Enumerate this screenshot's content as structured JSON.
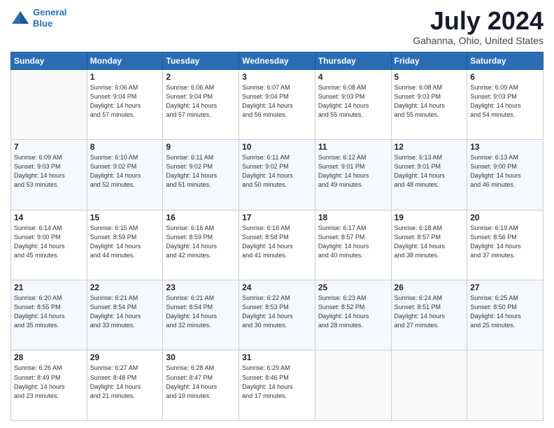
{
  "logo": {
    "line1": "General",
    "line2": "Blue"
  },
  "title": "July 2024",
  "subtitle": "Gahanna, Ohio, United States",
  "calendar": {
    "headers": [
      "Sunday",
      "Monday",
      "Tuesday",
      "Wednesday",
      "Thursday",
      "Friday",
      "Saturday"
    ],
    "rows": [
      [
        {
          "day": "",
          "info": ""
        },
        {
          "day": "1",
          "info": "Sunrise: 6:06 AM\nSunset: 9:04 PM\nDaylight: 14 hours\nand 57 minutes."
        },
        {
          "day": "2",
          "info": "Sunrise: 6:06 AM\nSunset: 9:04 PM\nDaylight: 14 hours\nand 57 minutes."
        },
        {
          "day": "3",
          "info": "Sunrise: 6:07 AM\nSunset: 9:04 PM\nDaylight: 14 hours\nand 56 minutes."
        },
        {
          "day": "4",
          "info": "Sunrise: 6:08 AM\nSunset: 9:03 PM\nDaylight: 14 hours\nand 55 minutes."
        },
        {
          "day": "5",
          "info": "Sunrise: 6:08 AM\nSunset: 9:03 PM\nDaylight: 14 hours\nand 55 minutes."
        },
        {
          "day": "6",
          "info": "Sunrise: 6:09 AM\nSunset: 9:03 PM\nDaylight: 14 hours\nand 54 minutes."
        }
      ],
      [
        {
          "day": "7",
          "info": "Sunrise: 6:09 AM\nSunset: 9:03 PM\nDaylight: 14 hours\nand 53 minutes."
        },
        {
          "day": "8",
          "info": "Sunrise: 6:10 AM\nSunset: 9:02 PM\nDaylight: 14 hours\nand 52 minutes."
        },
        {
          "day": "9",
          "info": "Sunrise: 6:11 AM\nSunset: 9:02 PM\nDaylight: 14 hours\nand 51 minutes."
        },
        {
          "day": "10",
          "info": "Sunrise: 6:11 AM\nSunset: 9:02 PM\nDaylight: 14 hours\nand 50 minutes."
        },
        {
          "day": "11",
          "info": "Sunrise: 6:12 AM\nSunset: 9:01 PM\nDaylight: 14 hours\nand 49 minutes."
        },
        {
          "day": "12",
          "info": "Sunrise: 6:13 AM\nSunset: 9:01 PM\nDaylight: 14 hours\nand 48 minutes."
        },
        {
          "day": "13",
          "info": "Sunrise: 6:13 AM\nSunset: 9:00 PM\nDaylight: 14 hours\nand 46 minutes."
        }
      ],
      [
        {
          "day": "14",
          "info": "Sunrise: 6:14 AM\nSunset: 9:00 PM\nDaylight: 14 hours\nand 45 minutes."
        },
        {
          "day": "15",
          "info": "Sunrise: 6:15 AM\nSunset: 8:59 PM\nDaylight: 14 hours\nand 44 minutes."
        },
        {
          "day": "16",
          "info": "Sunrise: 6:16 AM\nSunset: 8:59 PM\nDaylight: 14 hours\nand 42 minutes."
        },
        {
          "day": "17",
          "info": "Sunrise: 6:16 AM\nSunset: 8:58 PM\nDaylight: 14 hours\nand 41 minutes."
        },
        {
          "day": "18",
          "info": "Sunrise: 6:17 AM\nSunset: 8:57 PM\nDaylight: 14 hours\nand 40 minutes."
        },
        {
          "day": "19",
          "info": "Sunrise: 6:18 AM\nSunset: 8:57 PM\nDaylight: 14 hours\nand 38 minutes."
        },
        {
          "day": "20",
          "info": "Sunrise: 6:19 AM\nSunset: 8:56 PM\nDaylight: 14 hours\nand 37 minutes."
        }
      ],
      [
        {
          "day": "21",
          "info": "Sunrise: 6:20 AM\nSunset: 8:55 PM\nDaylight: 14 hours\nand 35 minutes."
        },
        {
          "day": "22",
          "info": "Sunrise: 6:21 AM\nSunset: 8:54 PM\nDaylight: 14 hours\nand 33 minutes."
        },
        {
          "day": "23",
          "info": "Sunrise: 6:21 AM\nSunset: 8:54 PM\nDaylight: 14 hours\nand 32 minutes."
        },
        {
          "day": "24",
          "info": "Sunrise: 6:22 AM\nSunset: 8:53 PM\nDaylight: 14 hours\nand 30 minutes."
        },
        {
          "day": "25",
          "info": "Sunrise: 6:23 AM\nSunset: 8:52 PM\nDaylight: 14 hours\nand 28 minutes."
        },
        {
          "day": "26",
          "info": "Sunrise: 6:24 AM\nSunset: 8:51 PM\nDaylight: 14 hours\nand 27 minutes."
        },
        {
          "day": "27",
          "info": "Sunrise: 6:25 AM\nSunset: 8:50 PM\nDaylight: 14 hours\nand 25 minutes."
        }
      ],
      [
        {
          "day": "28",
          "info": "Sunrise: 6:26 AM\nSunset: 8:49 PM\nDaylight: 14 hours\nand 23 minutes."
        },
        {
          "day": "29",
          "info": "Sunrise: 6:27 AM\nSunset: 8:48 PM\nDaylight: 14 hours\nand 21 minutes."
        },
        {
          "day": "30",
          "info": "Sunrise: 6:28 AM\nSunset: 8:47 PM\nDaylight: 14 hours\nand 19 minutes."
        },
        {
          "day": "31",
          "info": "Sunrise: 6:29 AM\nSunset: 8:46 PM\nDaylight: 14 hours\nand 17 minutes."
        },
        {
          "day": "",
          "info": ""
        },
        {
          "day": "",
          "info": ""
        },
        {
          "day": "",
          "info": ""
        }
      ]
    ]
  }
}
